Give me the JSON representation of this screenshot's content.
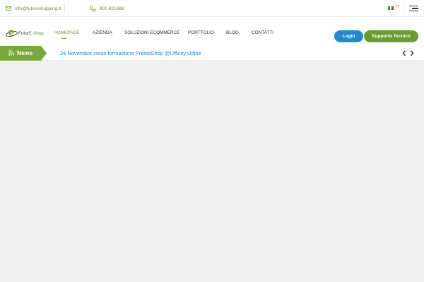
{
  "topbar": {
    "email": "info@futureshopping.it",
    "phone": "800 821888",
    "language": "IT"
  },
  "logo": {
    "text_main": "Futur",
    "text_accent": "E-Shop"
  },
  "nav": {
    "items": [
      {
        "label": "HOMEPAGE"
      },
      {
        "label": "AZIENDA"
      },
      {
        "label": "SOLUZIONI ECOMMERCE"
      },
      {
        "label": "PORTFOLIO"
      },
      {
        "label": "BLOG"
      },
      {
        "label": "CONTATTI"
      }
    ],
    "active_index": 0
  },
  "buttons": {
    "login": "Login",
    "support": "Supporto Tecnico"
  },
  "news": {
    "label": "News",
    "headline": "24 Novembre corso formazione PrestaShop @Ufficity Udine"
  },
  "colors": {
    "accent_green": "#6a9a2a",
    "accent_blue": "#1f8dcb",
    "news_green": "#79a93a",
    "content_bg": "#f0f0f0"
  },
  "icons": {
    "email": "envelope-icon",
    "phone": "phone-icon",
    "flag": "italy-flag-icon",
    "menu": "hamburger-icon",
    "rss": "rss-icon",
    "prev": "chevron-left-icon",
    "next": "chevron-right-icon"
  }
}
